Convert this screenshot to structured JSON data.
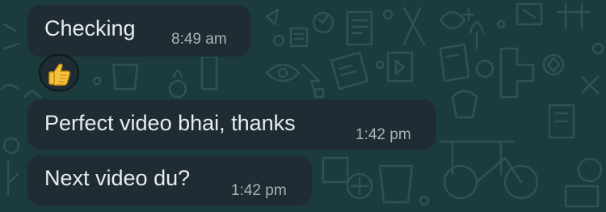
{
  "messages": [
    {
      "text": "Checking",
      "time": "8:49 am"
    },
    {
      "text": "Perfect video bhai, thanks",
      "time": "1:42 pm"
    },
    {
      "text": "Next video du?",
      "time": "1:42 pm"
    }
  ],
  "reaction": {
    "icon": "thumbs-up-icon"
  },
  "colors": {
    "wallpaper": "#1c3b3d",
    "bubble": "#1f2c33",
    "text": "#e9edef",
    "time": "#a9b3b9"
  }
}
